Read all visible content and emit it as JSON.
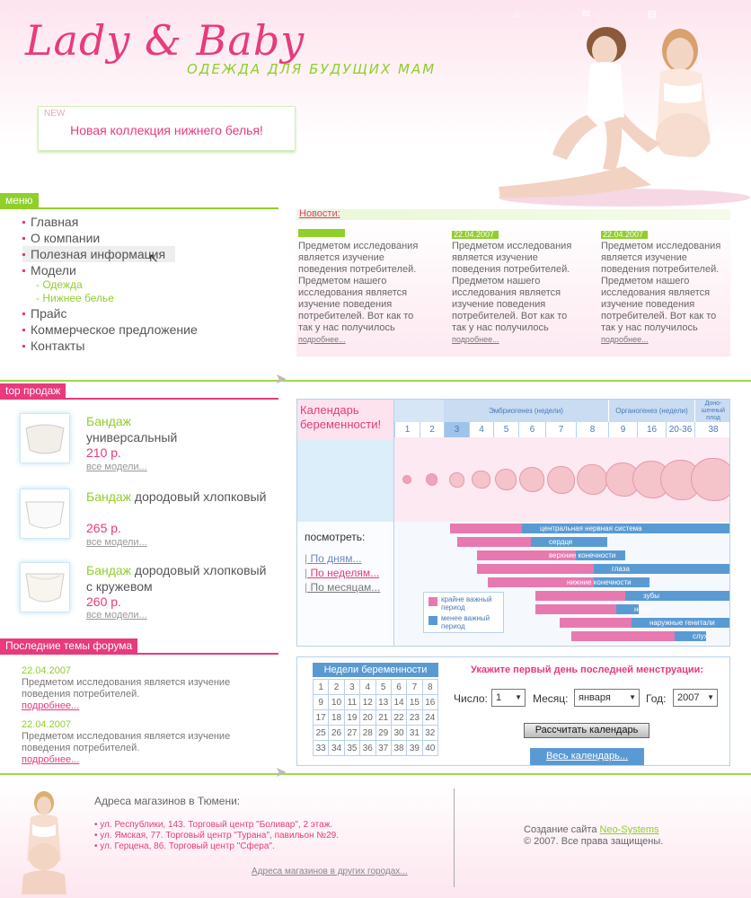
{
  "header": {
    "logo": "Lady & Baby",
    "slogan": "ОДЕЖДА ДЛЯ БУДУЩИХ МАМ",
    "new_badge": "NEW",
    "new_collection": "Новая коллекция нижнего белья!",
    "top_icons": [
      "home-icon",
      "mail-icon",
      "sitemap-icon"
    ]
  },
  "menu": {
    "label": "меню",
    "items": [
      "Главная",
      "О компании",
      "Полезная информация",
      "Модели"
    ],
    "subitems": [
      "- Одежда",
      "- Нижнее белье"
    ],
    "items2": [
      "Прайс",
      "Коммерческое предложение",
      "Контакты"
    ]
  },
  "news": {
    "title": "Новости:",
    "items": [
      {
        "date": "",
        "text": "Предметом исследования является изучение поведения потребителей. Предметом нашего исследования является изучение поведения потребителей. Вот как то так у нас получилось",
        "more": "подробнее..."
      },
      {
        "date": "22.04.2007",
        "text": "Предметом исследования является изучение поведения потребителей. Предметом нашего исследования является изучение поведения потребителей. Вот как то так у нас получилось",
        "more": "подробнее..."
      },
      {
        "date": "22.04.2007",
        "text": "Предметом исследования является изучение поведения потребителей. Предметом нашего исследования является изучение поведения потребителей. Вот как то так у нас получилось",
        "more": "подробнее..."
      }
    ]
  },
  "top_sales": {
    "label": "top продаж",
    "products": [
      {
        "name_hl": "Бандаж",
        "name": "универсальный",
        "price": "210 р.",
        "all": "все модели..."
      },
      {
        "name_hl": "Бандаж",
        "name": "дородовый хлопковый",
        "price": "265 р.",
        "all": "все модели..."
      },
      {
        "name_hl": "Бандаж",
        "name": "дородовый хлопковый с кружевом",
        "price": "260 р.",
        "all": "все модели..."
      }
    ]
  },
  "forum": {
    "label": "Последние темы форума",
    "posts": [
      {
        "date": "22.04.2007",
        "text": "Предметом исследования является изучение поведения потребителей.",
        "more": "подробнее..."
      },
      {
        "date": "22.04.2007",
        "text": "Предметом исследования является изучение поведения потребителей.",
        "more": "подробнее..."
      }
    ]
  },
  "calendar_chart": {
    "title": "Календарь беременности!",
    "embryo": "Эмбриогенез (недели)",
    "organo": "Органогенез (недели)",
    "fetus": "Доно-шенный плод",
    "weeks": [
      "1",
      "2",
      "3",
      "4",
      "5",
      "6",
      "7",
      "8",
      "9",
      "16",
      "20-36",
      "38"
    ],
    "view_title": "посмотреть:",
    "views": [
      "По дням...",
      "По неделям...",
      "По месяцам..."
    ],
    "bars": [
      "центральная нервная система",
      "сердце",
      "верхние конечности",
      "глаза",
      "нижние конечности",
      "зубы",
      "небо",
      "наружные генитали",
      "слух"
    ],
    "legend_critical": "крайне важный период",
    "legend_less": "менее важный период",
    "colors": {
      "critical": "#e878b0",
      "less": "#5a9ad3"
    }
  },
  "period_form": {
    "grid_title": "Недели беременности",
    "weeks": [
      1,
      2,
      3,
      4,
      5,
      6,
      7,
      8,
      9,
      10,
      11,
      12,
      13,
      14,
      15,
      16,
      17,
      18,
      19,
      20,
      21,
      22,
      23,
      24,
      25,
      26,
      27,
      28,
      29,
      30,
      31,
      32,
      33,
      34,
      35,
      36,
      37,
      38,
      39,
      40
    ],
    "prompt": "Укажите первый день последней менструации:",
    "day_label": "Число:",
    "day_value": "1",
    "month_label": "Месяц:",
    "month_value": "января",
    "year_label": "Год:",
    "year_value": "2007",
    "calc_button": "Рассчитать календарь",
    "full_button": "Весь календарь..."
  },
  "footer": {
    "title": "Адреса магазинов в Тюмени:",
    "addresses": [
      "• ул. Республики, 143. Торговый центр \"Боливар\", 2 этаж.",
      "• ул. Ямская, 77. Торговый центр \"Турана\", павильон №29.",
      "• ул. Герцена, 86. Торговый центр \"Сфера\"."
    ],
    "other": "Адреса магазинов в других городах...",
    "credit_prefix": "Создание сайта",
    "credit_link": "Neo-Systems",
    "copyright": "© 2007. Все права защищены."
  }
}
